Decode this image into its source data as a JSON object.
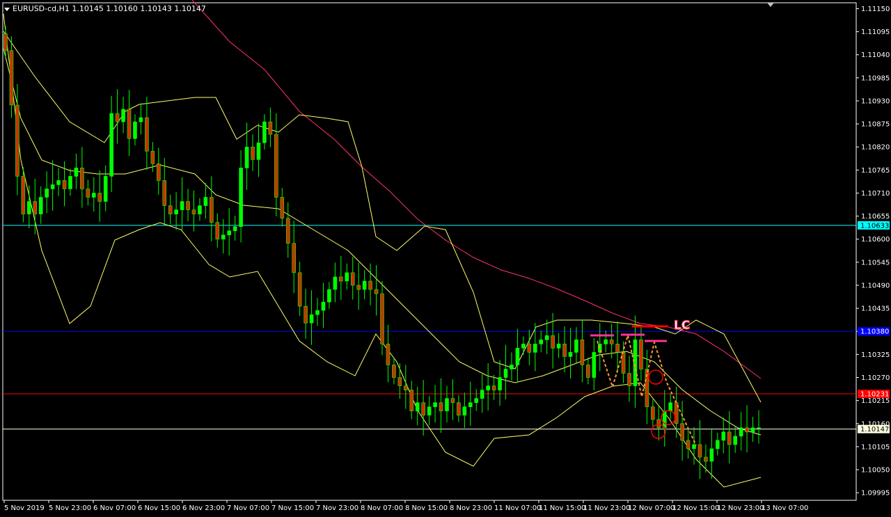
{
  "header": {
    "title": "EURUSD-cd,H1  1.10145 1.10160 1.10143 1.10147"
  },
  "chart_data": {
    "type": "candlestick",
    "symbol": "EURUSD-cd",
    "timeframe": "H1",
    "last_quote": {
      "open": 1.10145,
      "high": 1.1016,
      "low": 1.10143,
      "close": 1.10147
    },
    "y_range": [
      1.09977,
      1.11164
    ],
    "price_ticks": [
      "1.11150",
      "1.11095",
      "1.11040",
      "1.10985",
      "1.10930",
      "1.10875",
      "1.10820",
      "1.10765",
      "1.10710",
      "1.10655",
      "1.10600",
      "1.10545",
      "1.10490",
      "1.10435",
      "1.10380",
      "1.10325",
      "1.10270",
      "1.10215",
      "1.10160",
      "1.10105",
      "1.10050",
      "1.09995"
    ],
    "time_ticks": [
      "5 Nov 2019",
      "5 Nov 23:00",
      "6 Nov 07:00",
      "6 Nov 15:00",
      "6 Nov 23:00",
      "7 Nov 07:00",
      "7 Nov 15:00",
      "7 Nov 23:00",
      "8 Nov 07:00",
      "8 Nov 15:00",
      "8 Nov 23:00",
      "11 Nov 07:00",
      "11 Nov 15:00",
      "11 Nov 23:00",
      "12 Nov 07:00",
      "12 Nov 15:00",
      "12 Nov 23:00",
      "13 Nov 07:00"
    ],
    "horizontal_lines": [
      {
        "price": 1.10633,
        "label": "1.10633",
        "color": "#00ffff"
      },
      {
        "price": 1.1038,
        "label": "1.10380",
        "color": "#0000ff"
      },
      {
        "price": 1.10231,
        "label": "1.10231",
        "color": "#ff0000"
      },
      {
        "price": 1.10147,
        "label": "1.10147",
        "color": "#ffffe0"
      }
    ],
    "annotation_text": "LC",
    "colors": {
      "bull": "#00ff00",
      "bear": "#cc3300",
      "bands": "#ffff66",
      "ma": "#ff3366",
      "pink_marks": "#ff3399",
      "dashed": "#ff9933",
      "circles": "#ff0000"
    },
    "close_series": [
      1.1105,
      1.1092,
      1.1075,
      1.1066,
      1.1069,
      1.1066,
      1.107,
      1.1072,
      1.1073,
      1.1074,
      1.1072,
      1.1075,
      1.1077,
      1.1072,
      1.107,
      1.1071,
      1.1069,
      1.1075,
      1.109,
      1.1088,
      1.1091,
      1.1084,
      1.1088,
      1.1089,
      1.1081,
      1.1078,
      1.1074,
      1.1068,
      1.1066,
      1.1067,
      1.1069,
      1.1067,
      1.1066,
      1.1068,
      1.107,
      1.1064,
      1.106,
      1.1061,
      1.1062,
      1.1063,
      1.1077,
      1.1082,
      1.1079,
      1.1083,
      1.1088,
      1.1085,
      1.107,
      1.1065,
      1.1059,
      1.1052,
      1.1044,
      1.104,
      1.1042,
      1.1043,
      1.1045,
      1.1048,
      1.1051,
      1.105,
      1.1052,
      1.1049,
      1.1048,
      1.105,
      1.1048,
      1.1047,
      1.1035,
      1.103,
      1.1027,
      1.1025,
      1.1024,
      1.1019,
      1.1021,
      1.1018,
      1.102,
      1.1021,
      1.1019,
      1.1022,
      1.1021,
      1.1018,
      1.102,
      1.1021,
      1.1022,
      1.1024,
      1.1025,
      1.1024,
      1.1027,
      1.1029,
      1.103,
      1.1034,
      1.1035,
      1.1033,
      1.1035,
      1.1036,
      1.1037,
      1.1034,
      1.1035,
      1.1032,
      1.1033,
      1.1036,
      1.103,
      1.1027,
      1.1033,
      1.1035,
      1.1036,
      1.1035,
      1.1033,
      1.1028,
      1.1025,
      1.1036,
      1.1029,
      1.102,
      1.1017,
      1.1015,
      1.1019,
      1.1021,
      1.1016,
      1.1012,
      1.101,
      1.1011,
      1.1008,
      1.1007,
      1.101,
      1.1012,
      1.1014,
      1.1011,
      1.1013,
      1.1015,
      1.1014,
      1.1015,
      1.1015
    ],
    "ma_series": [
      [
        276,
        0
      ],
      [
        330,
        60
      ],
      [
        380,
        100
      ],
      [
        430,
        160
      ],
      [
        480,
        200
      ],
      [
        520,
        240
      ],
      [
        560,
        275
      ],
      [
        600,
        315
      ],
      [
        640,
        345
      ],
      [
        680,
        370
      ],
      [
        720,
        388
      ],
      [
        760,
        400
      ],
      [
        800,
        415
      ],
      [
        840,
        432
      ],
      [
        880,
        450
      ],
      [
        920,
        465
      ],
      [
        960,
        470
      ],
      [
        1000,
        480
      ],
      [
        1040,
        505
      ],
      [
        1093,
        544
      ]
    ],
    "band_upper": [
      [
        5,
        45
      ],
      [
        50,
        110
      ],
      [
        100,
        175
      ],
      [
        150,
        205
      ],
      [
        180,
        160
      ],
      [
        200,
        150
      ],
      [
        240,
        145
      ],
      [
        280,
        140
      ],
      [
        310,
        140
      ],
      [
        340,
        200
      ],
      [
        370,
        180
      ],
      [
        400,
        190
      ],
      [
        430,
        165
      ],
      [
        470,
        170
      ],
      [
        500,
        175
      ],
      [
        520,
        240
      ],
      [
        540,
        340
      ],
      [
        570,
        360
      ],
      [
        610,
        325
      ],
      [
        640,
        330
      ],
      [
        680,
        420
      ],
      [
        710,
        520
      ],
      [
        740,
        530
      ],
      [
        770,
        470
      ],
      [
        800,
        460
      ],
      [
        850,
        460
      ],
      [
        900,
        465
      ],
      [
        940,
        470
      ],
      [
        970,
        480
      ],
      [
        1000,
        460
      ],
      [
        1040,
        480
      ],
      [
        1093,
        578
      ]
    ],
    "band_middle": [
      [
        5,
        70
      ],
      [
        30,
        170
      ],
      [
        60,
        230
      ],
      [
        100,
        245
      ],
      [
        140,
        250
      ],
      [
        180,
        250
      ],
      [
        230,
        237
      ],
      [
        280,
        250
      ],
      [
        310,
        280
      ],
      [
        350,
        295
      ],
      [
        400,
        300
      ],
      [
        450,
        330
      ],
      [
        500,
        360
      ],
      [
        540,
        400
      ],
      [
        580,
        440
      ],
      [
        620,
        480
      ],
      [
        660,
        520
      ],
      [
        700,
        540
      ],
      [
        740,
        550
      ],
      [
        780,
        540
      ],
      [
        820,
        525
      ],
      [
        860,
        510
      ],
      [
        900,
        505
      ],
      [
        940,
        520
      ],
      [
        980,
        560
      ],
      [
        1020,
        590
      ],
      [
        1060,
        615
      ],
      [
        1093,
        625
      ]
    ],
    "band_lower": [
      [
        5,
        20
      ],
      [
        30,
        230
      ],
      [
        60,
        360
      ],
      [
        100,
        465
      ],
      [
        130,
        440
      ],
      [
        165,
        345
      ],
      [
        200,
        330
      ],
      [
        230,
        320
      ],
      [
        260,
        330
      ],
      [
        300,
        380
      ],
      [
        330,
        398
      ],
      [
        370,
        390
      ],
      [
        400,
        440
      ],
      [
        430,
        490
      ],
      [
        470,
        520
      ],
      [
        510,
        540
      ],
      [
        540,
        480
      ],
      [
        570,
        520
      ],
      [
        600,
        590
      ],
      [
        640,
        650
      ],
      [
        680,
        670
      ],
      [
        710,
        630
      ],
      [
        760,
        625
      ],
      [
        800,
        600
      ],
      [
        840,
        570
      ],
      [
        880,
        555
      ],
      [
        920,
        550
      ],
      [
        960,
        600
      ],
      [
        1000,
        660
      ],
      [
        1040,
        700
      ],
      [
        1093,
        686
      ]
    ],
    "dashed_path": [
      [
        858,
        490
      ],
      [
        880,
        556
      ],
      [
        902,
        482
      ],
      [
        922,
        570
      ],
      [
        940,
        492
      ],
      [
        958,
        550
      ],
      [
        1000,
        640
      ]
    ],
    "pink_segments": [
      [
        [
          848,
          482
        ],
        [
          882,
          482
        ]
      ],
      [
        [
          892,
          481
        ],
        [
          926,
          481
        ]
      ],
      [
        [
          926,
          490
        ],
        [
          958,
          490
        ]
      ]
    ],
    "red_segment": [
      [
        908,
        469
      ],
      [
        960,
        469
      ]
    ],
    "circles": [
      [
        942,
        542,
        10
      ],
      [
        960,
        600,
        10
      ],
      [
        946,
        620,
        10
      ]
    ]
  }
}
